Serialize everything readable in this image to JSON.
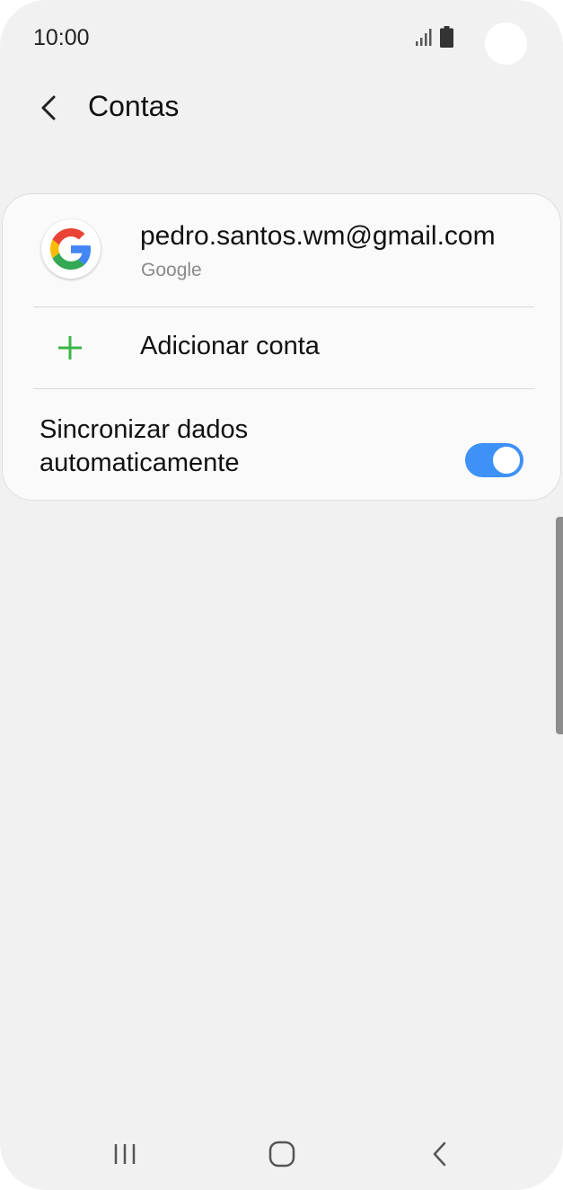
{
  "status_bar": {
    "time": "10:00",
    "signal_icon": "signal-bars-icon",
    "battery_icon": "battery-icon"
  },
  "app_bar": {
    "back_icon": "chevron-left-icon",
    "title": "Contas"
  },
  "account": {
    "icon": "google-logo-icon",
    "email": "pedro.santos.wm@gmail.com",
    "type": "Google"
  },
  "add_account": {
    "icon": "plus-icon",
    "label": "Adicionar conta"
  },
  "sync": {
    "label": "Sincronizar dados automaticamente",
    "enabled": true
  },
  "nav_bar": {
    "recents_icon": "recents-icon",
    "home_icon": "home-icon",
    "back_icon": "back-icon"
  },
  "colors": {
    "background": "#f1f1f1",
    "card": "#fafafa",
    "toggle_on": "#3e91f7",
    "plus_green": "#3bb54a"
  }
}
